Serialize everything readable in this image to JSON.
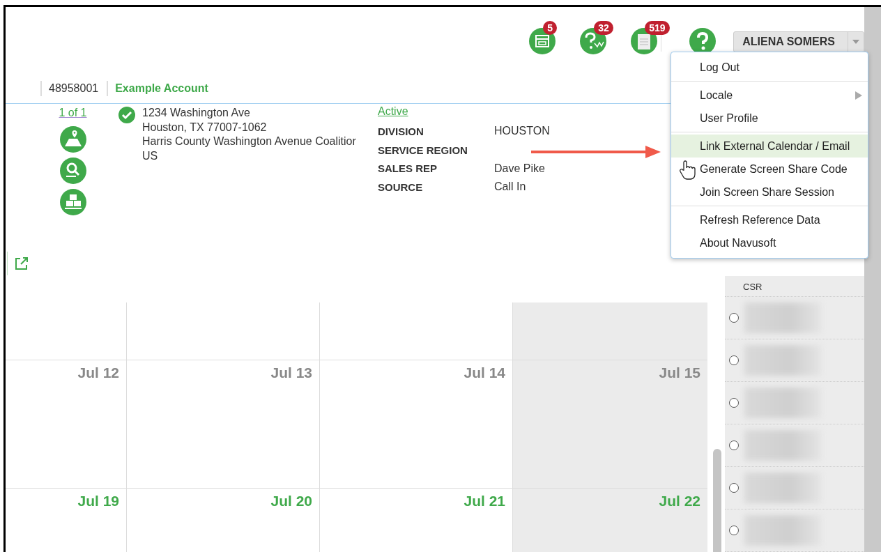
{
  "toolbar": {
    "alerts": [
      {
        "kind": "calendar",
        "count": "5"
      },
      {
        "kind": "help-chart",
        "count": "32"
      },
      {
        "kind": "document",
        "count": "519"
      }
    ],
    "user": "ALIENA SOMERS"
  },
  "account": {
    "number": "48958001",
    "name": "Example Account"
  },
  "location": {
    "pager": "1 of 1",
    "address": [
      "1234 Washington Ave",
      "Houston, TX 77007-1062",
      "Harris County Washington Avenue Coalitior",
      "US"
    ],
    "status": "Active",
    "fields": [
      {
        "label": "DIVISION",
        "value": "HOUSTON"
      },
      {
        "label": "SERVICE REGION"
      },
      {
        "label": "SALES REP",
        "value": "Dave Pike"
      },
      {
        "label": "SOURCE",
        "value": "Call In"
      }
    ]
  },
  "menu": {
    "groups": [
      [
        {
          "label": "Log Out",
          "selected": false,
          "submenu": false
        }
      ],
      [
        {
          "label": "Locale",
          "selected": false,
          "submenu": true
        },
        {
          "label": "User Profile",
          "selected": false,
          "submenu": false
        }
      ],
      [
        {
          "label": "Link External Calendar / Email",
          "selected": true,
          "submenu": false
        },
        {
          "label": "Generate Screen Share Code",
          "selected": false,
          "submenu": false
        },
        {
          "label": "Join Screen Share Session",
          "selected": false,
          "submenu": false
        }
      ],
      [
        {
          "label": "Refresh Reference Data",
          "selected": false,
          "submenu": false
        },
        {
          "label": "About Navusoft",
          "selected": false,
          "submenu": false
        }
      ]
    ]
  },
  "calendar": {
    "weeks": [
      {
        "days": [
          {
            "shaded": false
          },
          {
            "shaded": false
          },
          {
            "shaded": false
          },
          {
            "shaded": true
          }
        ]
      },
      {
        "days": [
          {
            "date": "Jul 12",
            "current": false,
            "shaded": false
          },
          {
            "date": "Jul 13",
            "current": false,
            "shaded": false
          },
          {
            "date": "Jul 14",
            "current": false,
            "shaded": false
          },
          {
            "date": "Jul 15",
            "current": false,
            "shaded": true
          }
        ]
      },
      {
        "days": [
          {
            "date": "Jul 19",
            "current": true,
            "shaded": false
          },
          {
            "date": "Jul 20",
            "current": true,
            "shaded": false
          },
          {
            "date": "Jul 21",
            "current": true,
            "shaded": false
          },
          {
            "date": "Jul 22",
            "current": true,
            "shaded": true
          }
        ]
      }
    ]
  },
  "resource_panel": {
    "first_label": "CSR",
    "rows": [
      {
        "selected": false
      },
      {
        "selected": false
      },
      {
        "selected": false
      },
      {
        "selected": false
      },
      {
        "selected": false
      },
      {
        "selected": false
      }
    ]
  }
}
